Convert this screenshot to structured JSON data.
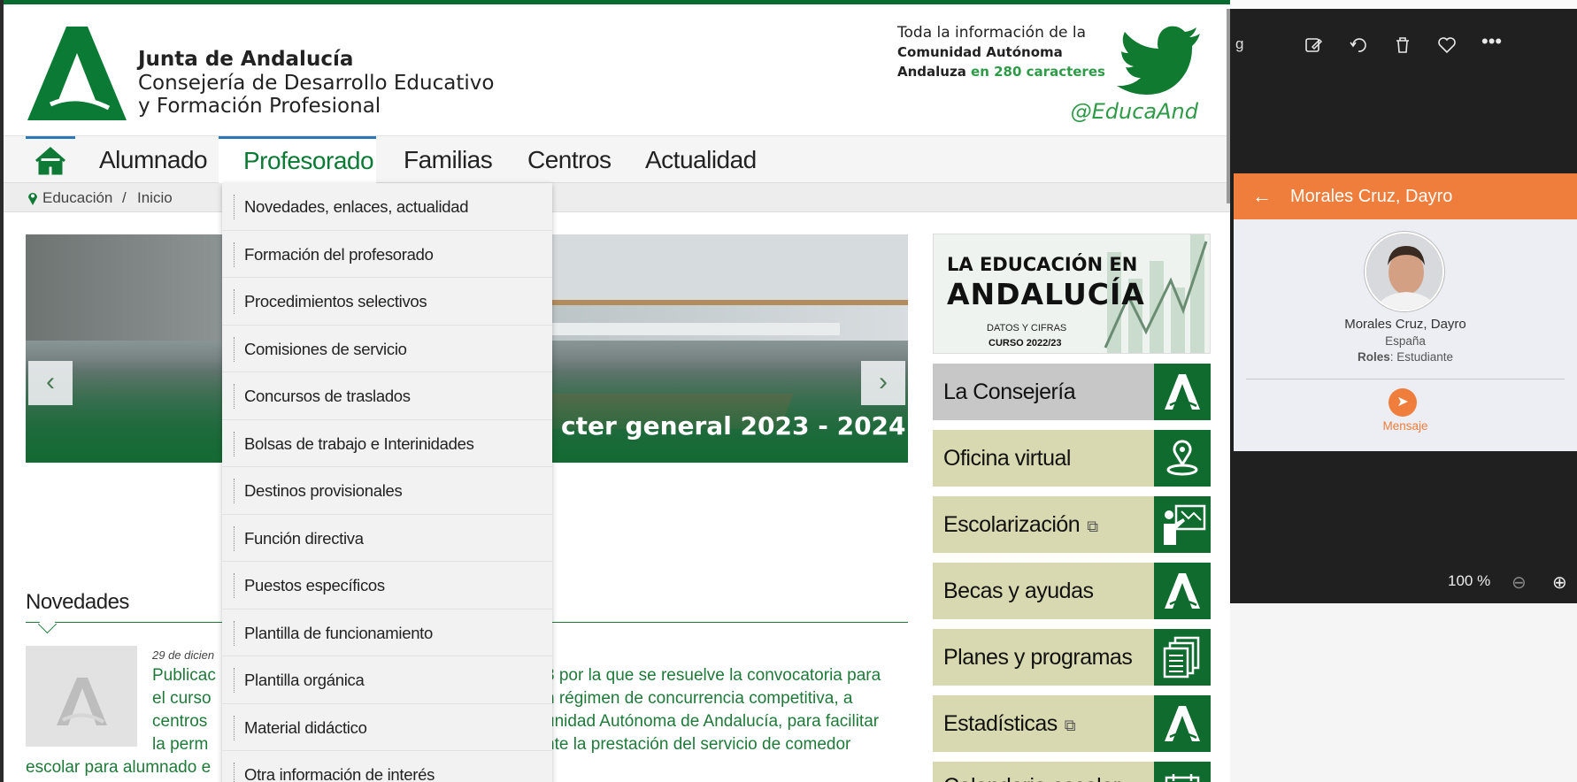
{
  "header": {
    "brand_title": "Junta de Andalucía",
    "brand_sub1": "Consejería de Desarrollo Educativo",
    "brand_sub2": "y Formación Profesional",
    "twitter_line1": "Toda la información de la",
    "twitter_line2": "Comunidad Autónoma",
    "twitter_line3a": "Andaluza",
    "twitter_line3b": " en 280 caracteres",
    "twitter_handle": "@EducaAnd",
    "brand_color": "#0a6b31"
  },
  "nav": {
    "items": [
      {
        "label": "Alumnado"
      },
      {
        "label": "Profesorado"
      },
      {
        "label": "Familias"
      },
      {
        "label": "Centros"
      },
      {
        "label": "Actualidad"
      }
    ],
    "active": "Profesorado"
  },
  "breadcrumb": {
    "items": [
      "Educación",
      "/",
      "Inicio"
    ]
  },
  "dropdown": {
    "items": [
      "Novedades, enlaces, actualidad",
      "Formación del profesorado",
      "Procedimientos selectivos",
      "Comisiones de servicio",
      "Concursos de traslados",
      "Bolsas de trabajo e Interinidades",
      "Destinos provisionales",
      "Función directiva",
      "Puestos específicos",
      "Plantilla de funcionamiento",
      "Plantilla orgánica",
      "Material didáctico",
      "Otra información de interés"
    ]
  },
  "carousel": {
    "caption": "cter general 2023 - 2024 »",
    "prev": "‹",
    "next": "›"
  },
  "novedades": {
    "title": "Novedades",
    "date": "29 de dicien",
    "lines": [
      "Publicac",
      "3 por la que se resuelve la convocatoria para",
      "el curso",
      "n régimen de concurrencia competitiva, a",
      "centros",
      "unidad Autónoma de Andalucía, para facilitar",
      "la perm",
      "nte la prestación del servicio de comedor",
      "escolar para alumnado e"
    ]
  },
  "right_column": {
    "banner": {
      "line1": "LA EDUCACIÓN EN",
      "line2": "ANDALUCÍA",
      "line3": "DATOS Y CIFRAS",
      "line4": "CURSO 2022/23"
    },
    "tiles": [
      {
        "label": "La Consejería",
        "icon": "junta-logo-icon",
        "external": false
      },
      {
        "label": "Oficina virtual",
        "icon": "location-pin-icon",
        "external": false
      },
      {
        "label": "Escolarización",
        "icon": "teacher-board-icon",
        "external": true
      },
      {
        "label": "Becas y ayudas",
        "icon": "junta-logo-icon",
        "external": false
      },
      {
        "label": "Planes y programas",
        "icon": "documents-icon",
        "external": false
      },
      {
        "label": "Estadísticas",
        "icon": "junta-logo-icon",
        "external": true
      },
      {
        "label": "Calendario escolar",
        "icon": "calendar-icon",
        "external": true
      }
    ]
  },
  "side_app": {
    "cut_label": "g",
    "contact_header": "Morales Cruz, Dayro",
    "contact_name": "Morales Cruz, Dayro",
    "contact_country": "España",
    "roles_label": "Roles",
    "roles_value": ": Estudiante",
    "message_label": "Mensaje",
    "zoom": "100 %",
    "accent": "#ef7d3c"
  }
}
